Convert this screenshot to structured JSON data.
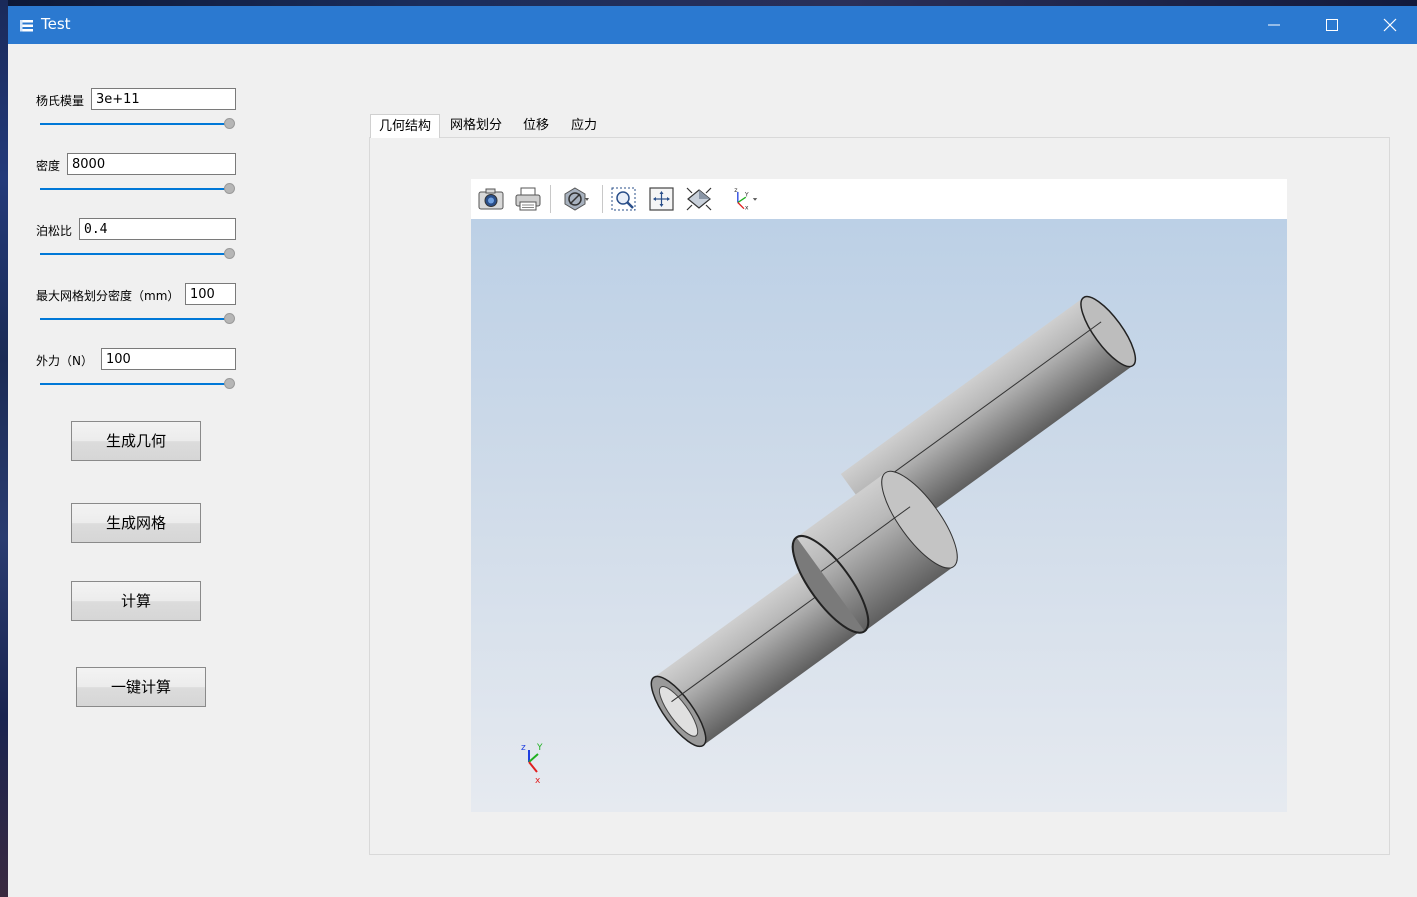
{
  "window": {
    "title": "Test"
  },
  "params": {
    "youngs_modulus": {
      "label": "杨氏模量",
      "value": "3e+11"
    },
    "density": {
      "label": "密度",
      "value": "8000"
    },
    "poisson": {
      "label": "泊松比",
      "value": "0.4"
    },
    "mesh_density": {
      "label": "最大网格划分密度（mm）",
      "value": "100"
    },
    "force": {
      "label": "外力（N）",
      "value": "100"
    }
  },
  "buttons": {
    "generate_geometry": "生成几何",
    "generate_mesh": "生成网格",
    "compute": "计算",
    "one_click": "一键计算"
  },
  "tabs": [
    "几何结构",
    "网格划分",
    "位移",
    "应力"
  ],
  "active_tab": "几何结构",
  "viewer": {
    "toolbar_icons": [
      "camera-icon",
      "printer-icon",
      "clip-plane-icon",
      "zoom-box-icon",
      "fit-all-icon",
      "view-iso-icon",
      "axes-triad-icon"
    ],
    "axis_labels": {
      "x": "x",
      "y": "Y",
      "z": "z"
    },
    "colors": {
      "x_axis": "#e02020",
      "y_axis": "#20b020",
      "z_axis": "#2040e0",
      "shaft": "#9a9a9a"
    }
  },
  "colors": {
    "titlebar": "#2b79d0",
    "slider": "#0078d7"
  }
}
